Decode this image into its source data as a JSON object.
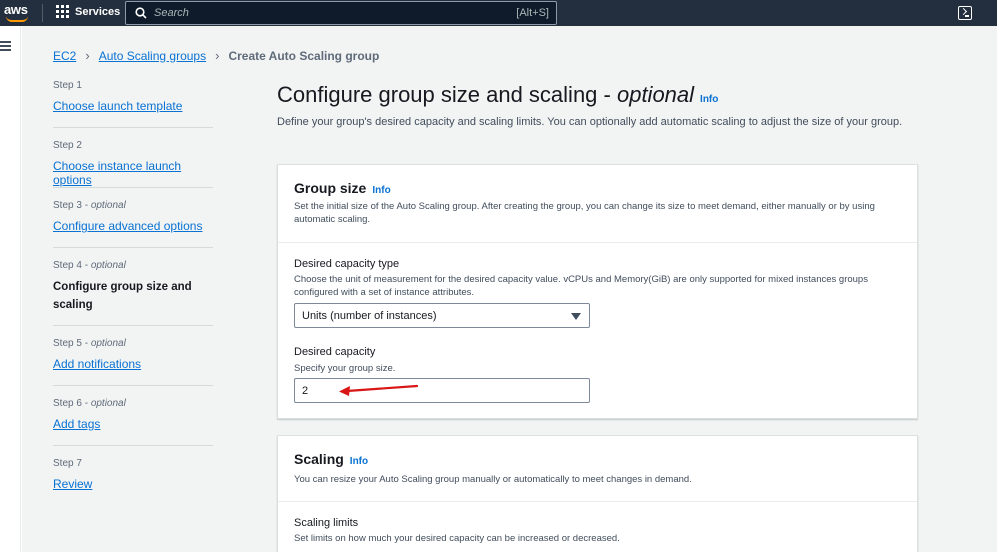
{
  "topnav": {
    "logo": "aws",
    "services_label": "Services",
    "search_placeholder": "Search",
    "search_shortcut": "[Alt+S]",
    "icons": [
      "aws-logo",
      "grid-icon",
      "search-icon",
      "cloudshell-icon"
    ]
  },
  "leftrail": {
    "icon": "hamburger-menu-icon"
  },
  "breadcrumb": {
    "items": [
      "EC2",
      "Auto Scaling groups"
    ],
    "current": "Create Auto Scaling group"
  },
  "steps": [
    {
      "number": "Step 1",
      "optional": "",
      "label": "Choose launch template"
    },
    {
      "number": "Step 2",
      "optional": "",
      "label": "Choose instance launch options"
    },
    {
      "number": "Step 3 - ",
      "optional": "optional",
      "label": "Configure advanced options"
    },
    {
      "number": "Step 4 - ",
      "optional": "optional",
      "label": "Configure group size and scaling"
    },
    {
      "number": "Step 5 - ",
      "optional": "optional",
      "label": "Add notifications"
    },
    {
      "number": "Step 6 - ",
      "optional": "optional",
      "label": "Add tags"
    },
    {
      "number": "Step 7",
      "optional": "",
      "label": "Review"
    }
  ],
  "page": {
    "title": "Configure group size and scaling - ",
    "title_optional": "optional",
    "info": "Info",
    "description": "Define your group's desired capacity and scaling limits. You can optionally add automatic scaling to adjust the size of your group."
  },
  "group_size": {
    "title": "Group size",
    "info": "Info",
    "description": "Set the initial size of the Auto Scaling group. After creating the group, you can change its size to meet demand, either manually or by using automatic scaling.",
    "capacity_type_label": "Desired capacity type",
    "capacity_type_desc": "Choose the unit of measurement for the desired capacity value. vCPUs and Memory(GiB) are only supported for mixed instances groups configured with a set of instance attributes.",
    "capacity_type_value": "Units (number of instances)",
    "desired_label": "Desired capacity",
    "desired_desc": "Specify your group size.",
    "desired_value": "2"
  },
  "scaling": {
    "title": "Scaling",
    "info": "Info",
    "description": "You can resize your Auto Scaling group manually or automatically to meet changes in demand.",
    "limits_label": "Scaling limits",
    "limits_desc": "Set limits on how much your desired capacity can be increased or decreased."
  },
  "colors": {
    "nav_bg": "#232f3e",
    "link": "#0972d3",
    "annotation_arrow": "#d91515",
    "page_bg": "#f2f3f3"
  }
}
